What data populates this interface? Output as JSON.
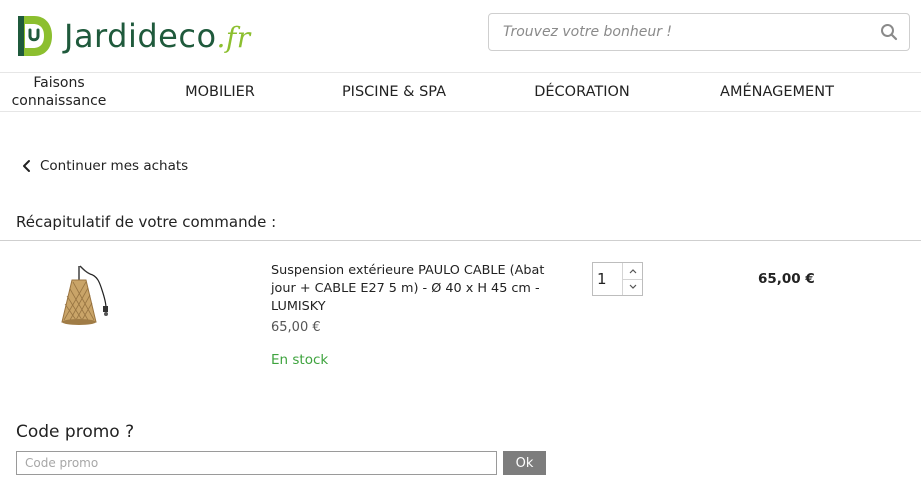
{
  "brand": {
    "logo_mark": "D",
    "name": "Jardideco",
    "tld": ".fr",
    "colors": {
      "dark": "#1f5a3c",
      "light": "#8cbf2f"
    }
  },
  "search": {
    "placeholder": "Trouvez votre bonheur !",
    "icon": "search-icon"
  },
  "nav": {
    "items": [
      {
        "label": "Faisons connaissance"
      },
      {
        "label": "MOBILIER"
      },
      {
        "label": "PISCINE & SPA"
      },
      {
        "label": "DÉCORATION"
      },
      {
        "label": "AMÉNAGEMENT"
      }
    ]
  },
  "back_link": {
    "label": "Continuer mes achats",
    "icon": "chevron-left-icon"
  },
  "summary": {
    "title": "Récapitulatif de votre commande :"
  },
  "cart": {
    "items": [
      {
        "title": "Suspension extérieure PAULO CABLE (Abat jour + CABLE E27 5 m) - Ø 40 x H 45 cm - LUMISKY",
        "unit_price": "65,00 €",
        "stock": "En stock",
        "quantity": "1",
        "line_total": "65,00 €"
      }
    ]
  },
  "promo": {
    "title": "Code promo ?",
    "placeholder": "Code promo",
    "button": "Ok"
  },
  "colors": {
    "stock_green": "#3ea33e",
    "ok_button": "#7d7d7d"
  }
}
